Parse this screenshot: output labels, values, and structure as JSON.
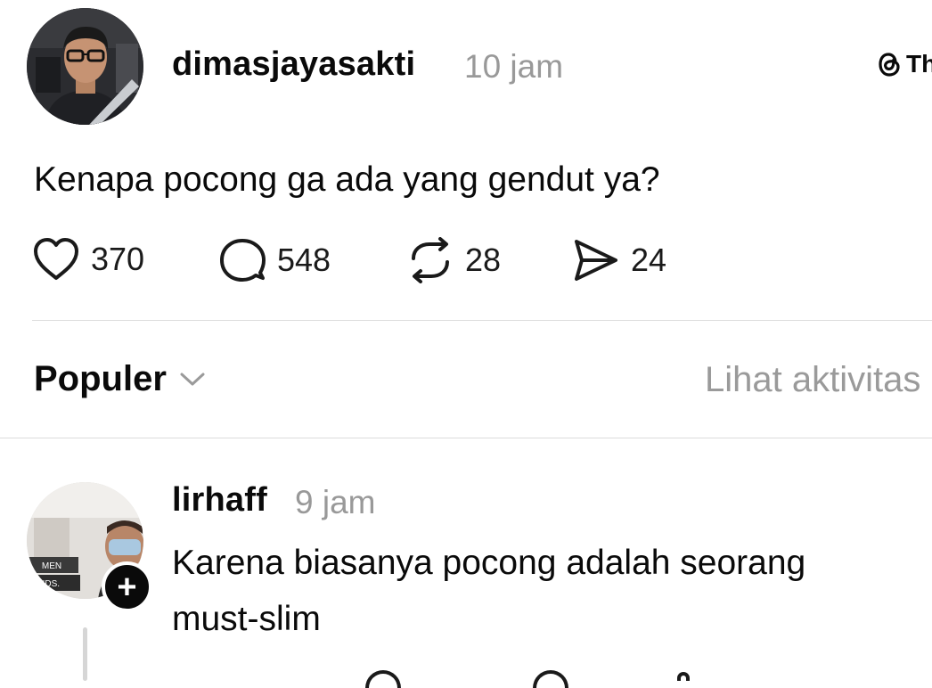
{
  "post": {
    "username": "dimasjayasakti",
    "time": "10 jam",
    "text": "Kenapa pocong ga ada yang gendut ya?",
    "likes": "370",
    "replies": "548",
    "reposts": "28",
    "shares": "24"
  },
  "header": {
    "threads_label": "Th"
  },
  "sort": {
    "label": "Populer",
    "activity_link": "Lihat aktivitas"
  },
  "reply": {
    "username": "lirhaff",
    "time": "9 jam",
    "text_line1": "Karena biasanya pocong adalah seorang",
    "text_line2": "must-slim",
    "avatar_sign_top": "MEN",
    "avatar_sign_bottom": "KIDS."
  },
  "icons": {
    "like": "heart-icon",
    "reply": "comment-bubble-icon",
    "repost": "repost-icon",
    "share": "send-icon",
    "sort": "chevron-down-icon",
    "threads": "threads-logo-icon",
    "follow": "plus-icon"
  },
  "colors": {
    "text": "#0a0a0a",
    "muted": "#999999",
    "divider": "#dcdcdc",
    "badge": "#0a0a0a"
  }
}
